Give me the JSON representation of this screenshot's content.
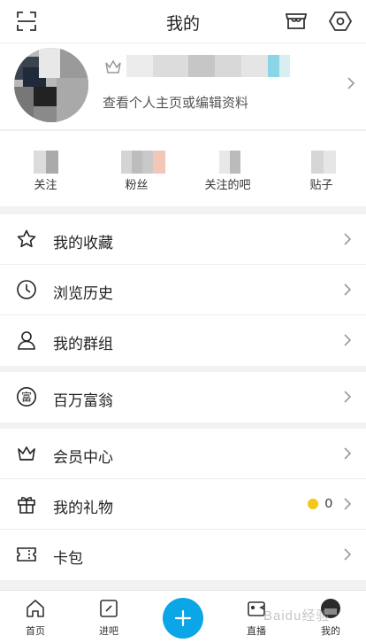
{
  "header": {
    "title": "我的",
    "scan_icon": "scan-icon",
    "store_icon": "store-icon",
    "settings_icon": "settings-hexagon-icon"
  },
  "profile": {
    "subtitle": "查看个人主页或编辑资料",
    "crown_icon": "crown-icon"
  },
  "stats": [
    {
      "label": "关注"
    },
    {
      "label": "粉丝"
    },
    {
      "label": "关注的吧"
    },
    {
      "label": "贴子"
    }
  ],
  "menu_groups": [
    [
      {
        "label": "我的收藏",
        "icon": "star-icon"
      },
      {
        "label": "浏览历史",
        "icon": "clock-icon"
      },
      {
        "label": "我的群组",
        "icon": "person-icon"
      }
    ],
    [
      {
        "label": "百万富翁",
        "icon": "rich-icon"
      }
    ],
    [
      {
        "label": "会员中心",
        "icon": "crown-icon"
      },
      {
        "label": "我的礼物",
        "icon": "gift-icon",
        "value": "0"
      },
      {
        "label": "卡包",
        "icon": "ticket-icon"
      }
    ]
  ],
  "tabbar": [
    {
      "label": "首页",
      "icon": "home-icon"
    },
    {
      "label": "进吧",
      "icon": "enter-bar-icon"
    },
    {
      "label": "直播",
      "icon": "live-video-icon"
    },
    {
      "label": "我的",
      "icon": "avatar-icon"
    }
  ],
  "fab_icon": "plus-icon",
  "watermark": "Baidu经验",
  "colors": {
    "accent": "#0aa6e8",
    "coin": "#f5c518"
  }
}
